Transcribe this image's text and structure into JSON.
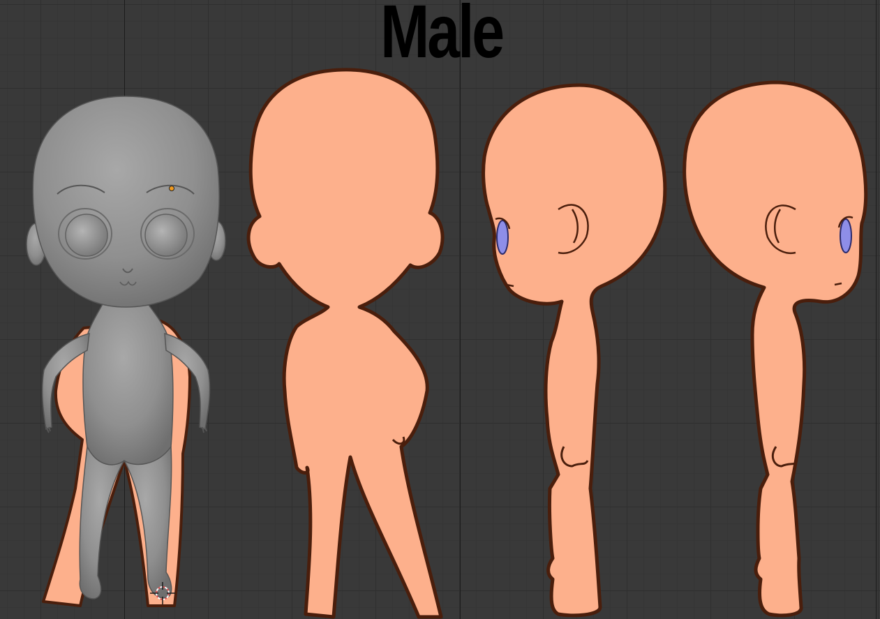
{
  "sheet": {
    "title": "Male"
  },
  "colors": {
    "background": "#393939",
    "skin": "#FDB08C",
    "outline": "#4A1E0C",
    "mesh": "#8E8E8E",
    "vertex_highlight": "#F29A1D"
  },
  "icons": {
    "cursor": "3d-cursor-icon"
  }
}
